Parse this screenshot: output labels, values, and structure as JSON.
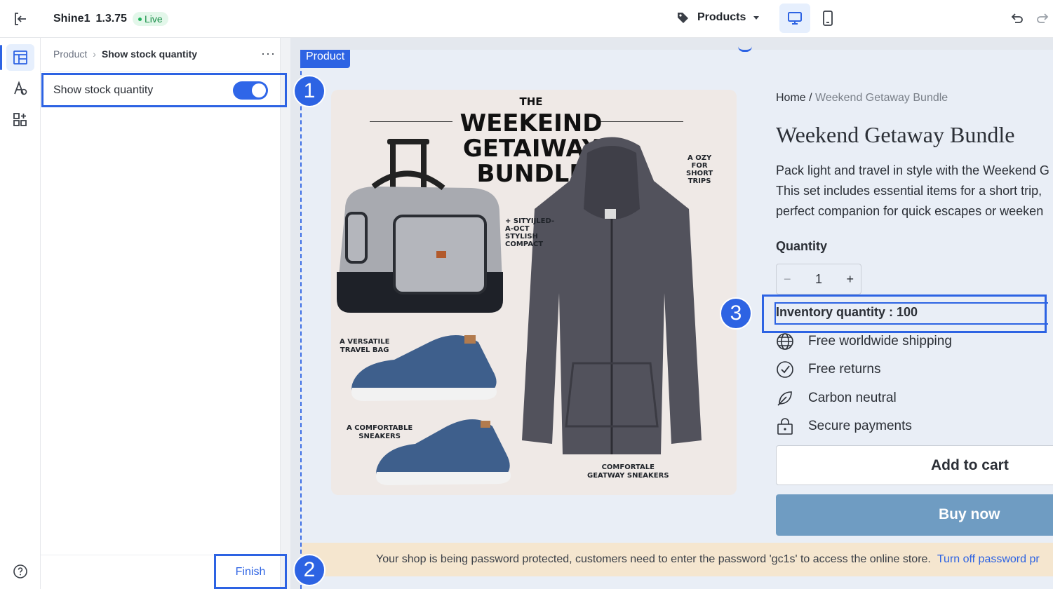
{
  "topbar": {
    "store_name": "Shine1",
    "version": "1.3.75",
    "status": "Live",
    "page_selector": "Products"
  },
  "panel": {
    "breadcrumb_parent": "Product",
    "breadcrumb_current": "Show stock quantity",
    "setting_label": "Show stock quantity",
    "toggle_on": true,
    "finish_label": "Finish"
  },
  "preview": {
    "section_tag": "Product",
    "breadcrumb_home": "Home /",
    "breadcrumb_current": "Weekend Getaway Bundle",
    "product_title": "Weekend Getaway Bundle",
    "description_lines": [
      "Pack light and travel in style with the Weekend G",
      "This set includes essential items for a short trip,",
      "perfect companion for quick escapes or weeken"
    ],
    "quantity_label": "Quantity",
    "quantity_value": "1",
    "minus": "−",
    "plus": "+",
    "inventory_text": "Inventory quantity : 100",
    "features": [
      {
        "icon": "globe-icon",
        "label": "Free worldwide shipping"
      },
      {
        "icon": "check-circle-icon",
        "label": "Free returns"
      },
      {
        "icon": "leaf-icon",
        "label": "Carbon neutral"
      },
      {
        "icon": "lock-icon",
        "label": "Secure payments"
      }
    ],
    "add_to_cart": "Add to cart",
    "buy_now": "Buy now",
    "password_notice": "Your shop is being password protected, customers need to enter the password 'gc1s' to access the online store.",
    "password_link": "Turn off password pr"
  },
  "product_image": {
    "title_lines": [
      "THE",
      "WEEKEIND",
      "GETAIWAY",
      "BUNDLE"
    ],
    "label_cozy": [
      "A OZY",
      "FOR",
      "SHORT",
      "TRIPS"
    ],
    "label_stylish": [
      "+ SITYIJLED-",
      "A-OCT",
      "STYLISH",
      "COMPACT"
    ],
    "label_bag": [
      "A VERSATILE",
      "TRAVEL BAG"
    ],
    "label_sneakers": [
      "A COMFORTABLE",
      "SNEAKERS"
    ],
    "label_bottom": [
      "COMFORTALE",
      "GEATWAY SNEAKERS"
    ]
  },
  "callouts": [
    "1",
    "2",
    "3"
  ],
  "colors": {
    "accent": "#2d63e3",
    "buy_now": "#6f9cc2",
    "notice_bg": "#f5e6cf"
  }
}
